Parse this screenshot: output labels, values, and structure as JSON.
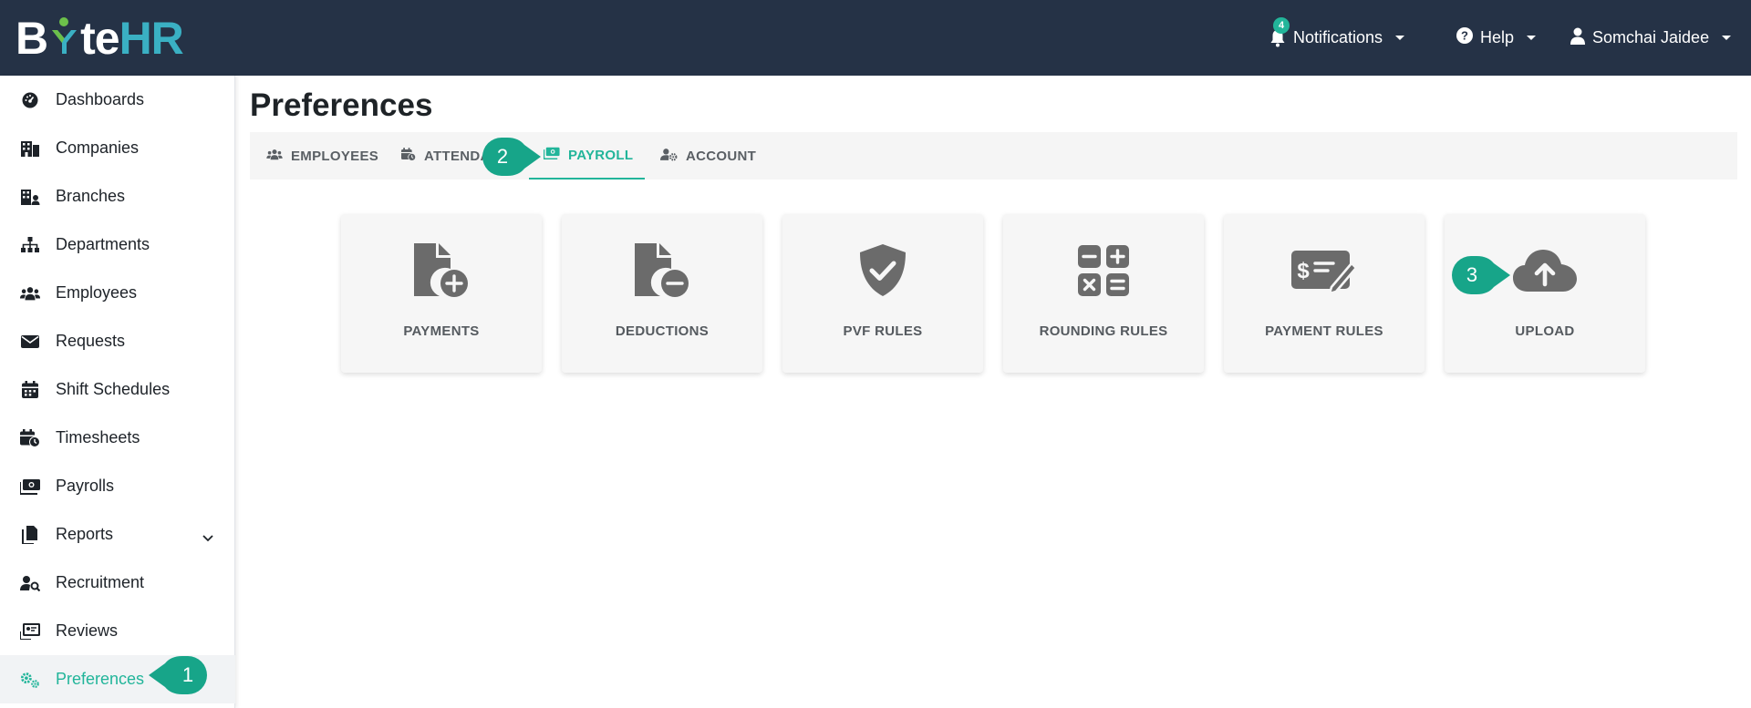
{
  "app": {
    "logo_parts": {
      "by": "B",
      "te": "te",
      "hr": "HR"
    },
    "accent_color": "#22b59a",
    "navbar_color": "#253246"
  },
  "navbar": {
    "notifications": {
      "label": "Notifications",
      "count": "4",
      "icon": "bell-icon"
    },
    "help": {
      "label": "Help",
      "icon": "question-circle-icon"
    },
    "user": {
      "label": "Somchai Jaidee",
      "icon": "user-icon"
    }
  },
  "sidebar": {
    "items": [
      {
        "label": "Dashboards",
        "icon": "gauge-icon"
      },
      {
        "label": "Companies",
        "icon": "building-icon"
      },
      {
        "label": "Branches",
        "icon": "branch-building-icon"
      },
      {
        "label": "Departments",
        "icon": "sitemap-icon"
      },
      {
        "label": "Employees",
        "icon": "users-icon"
      },
      {
        "label": "Requests",
        "icon": "envelope-icon"
      },
      {
        "label": "Shift Schedules",
        "icon": "calendar-icon"
      },
      {
        "label": "Timesheets",
        "icon": "calendar-clock-icon"
      },
      {
        "label": "Payrolls",
        "icon": "money-bill-icon"
      },
      {
        "label": "Reports",
        "icon": "copy-icon",
        "has_submenu": true
      },
      {
        "label": "Recruitment",
        "icon": "user-search-icon"
      },
      {
        "label": "Reviews",
        "icon": "review-icon"
      },
      {
        "label": "Preferences",
        "icon": "gears-icon",
        "active": true
      }
    ]
  },
  "main": {
    "title": "Preferences",
    "tabs": [
      {
        "label": "EMPLOYEES",
        "icon": "users-icon"
      },
      {
        "label": "ATTENDA",
        "icon": "calendar-clock-icon"
      },
      {
        "label": "PAYROLL",
        "icon": "money-bill-icon",
        "active": true
      },
      {
        "label": "ACCOUNT",
        "icon": "user-gear-icon"
      }
    ],
    "cards": [
      {
        "label": "PAYMENTS",
        "icon": "file-plus-icon"
      },
      {
        "label": "DEDUCTIONS",
        "icon": "file-minus-icon"
      },
      {
        "label": "PVF RULES",
        "icon": "shield-check-icon"
      },
      {
        "label": "ROUNDING RULES",
        "icon": "calculator-icon"
      },
      {
        "label": "PAYMENT RULES",
        "icon": "money-check-pen-icon"
      },
      {
        "label": "UPLOAD",
        "icon": "cloud-upload-icon"
      }
    ]
  },
  "callouts": [
    {
      "number": "1"
    },
    {
      "number": "2"
    },
    {
      "number": "3"
    }
  ]
}
